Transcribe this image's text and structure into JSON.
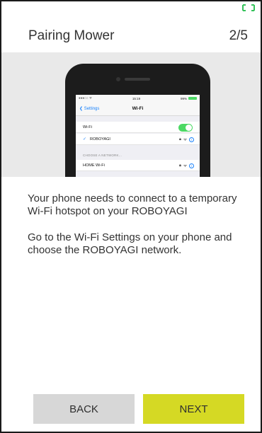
{
  "header": {
    "title": "Pairing Mower",
    "step": "2/5"
  },
  "status_icon": {
    "name": "fullscreen-brackets-icon",
    "color": "#35c25b"
  },
  "illustration": {
    "time": "15:19",
    "battery": "99%",
    "back_label": "Settings",
    "nav_title": "Wi-Fi",
    "wifi_label": "Wi-Fi",
    "connected_network": "ROBOYAGI",
    "section_label": "CHOOSE A NETWORK...",
    "other_network": "HOME Wi-Fi"
  },
  "body": {
    "paragraph1": "Your phone needs to connect to a temporary Wi-Fi hotspot on your ROBOYAGI",
    "paragraph2": "Go to the Wi-Fi Settings on your phone and choose the ROBOYAGI network."
  },
  "buttons": {
    "back_label": "BACK",
    "next_label": "NEXT"
  },
  "colors": {
    "next_bg": "#d5d924",
    "back_bg": "#d7d7d7",
    "hero_bg": "#e9e9e9"
  }
}
